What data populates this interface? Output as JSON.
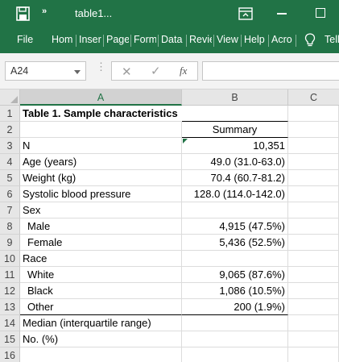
{
  "titlebar": {
    "more_glyph": "»",
    "doc_title": "table1...",
    "accent_color": "#217346"
  },
  "ribbon": {
    "tabs": [
      "File",
      "Hom",
      "Inser",
      "Page",
      "Form",
      "Data",
      "Revie",
      "View",
      "Help",
      "Acro",
      "Tell"
    ]
  },
  "formula_bar": {
    "name_box": "A24",
    "dots": "⋮",
    "cancel_glyph": "✕",
    "enter_glyph": "✓",
    "fx_label": "fx",
    "value": ""
  },
  "columns": [
    "A",
    "B",
    "C"
  ],
  "rows": [
    {
      "num": "1",
      "a": "Table 1. Sample characteristics",
      "b": ""
    },
    {
      "num": "2",
      "a": "",
      "b": "Summary"
    },
    {
      "num": "3",
      "a": "N",
      "b": "10,351"
    },
    {
      "num": "4",
      "a": "Age (years)",
      "b": "49.0 (31.0-63.0)"
    },
    {
      "num": "5",
      "a": "Weight (kg)",
      "b": "70.4 (60.7-81.2)"
    },
    {
      "num": "6",
      "a": "Systolic blood pressure",
      "b": "128.0 (114.0-142.0)"
    },
    {
      "num": "7",
      "a": "Sex",
      "b": ""
    },
    {
      "num": "8",
      "a": "Male",
      "b": "4,915 (47.5%)"
    },
    {
      "num": "9",
      "a": "Female",
      "b": "5,436 (52.5%)"
    },
    {
      "num": "10",
      "a": "Race",
      "b": ""
    },
    {
      "num": "11",
      "a": "White",
      "b": "9,065 (87.6%)"
    },
    {
      "num": "12",
      "a": "Black",
      "b": "1,086 (10.5%)"
    },
    {
      "num": "13",
      "a": "Other",
      "b": "200 (1.9%)"
    },
    {
      "num": "14",
      "a": "Median (interquartile range)",
      "b": ""
    },
    {
      "num": "15",
      "a": "No. (%)",
      "b": ""
    },
    {
      "num": "16",
      "a": "",
      "b": ""
    }
  ]
}
